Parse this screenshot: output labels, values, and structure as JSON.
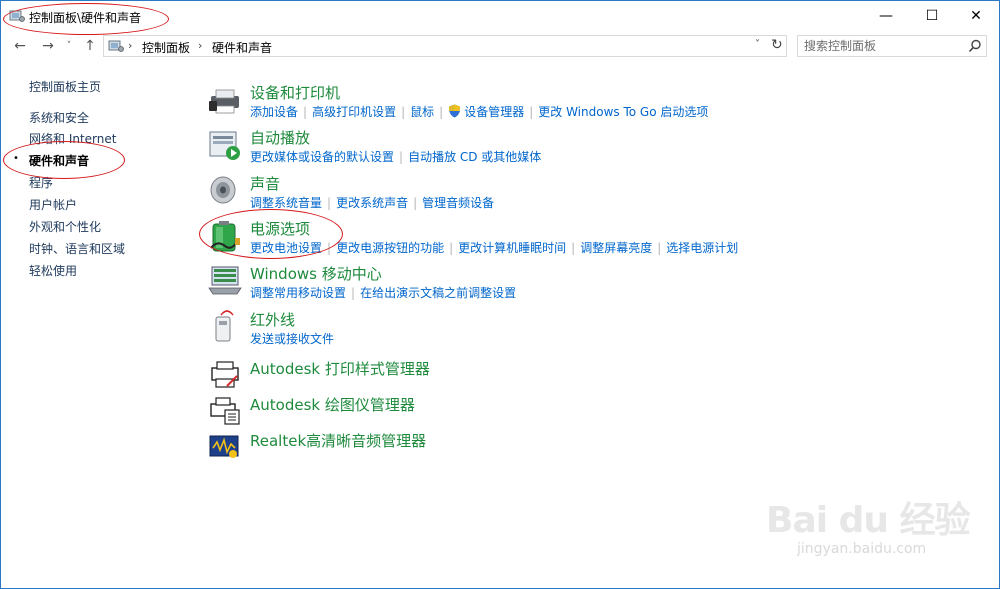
{
  "window": {
    "title": "控制面板\\硬件和声音",
    "minimize": "—",
    "maximize": "☐",
    "close": "✕"
  },
  "nav": {
    "back": "←",
    "forward": "→",
    "recent": "˅",
    "up": "↑",
    "breadcrumb": [
      "控制面板",
      "硬件和声音"
    ],
    "dropdown": "˅",
    "refresh": "↻",
    "search_placeholder": "搜索控制面板"
  },
  "sidebar": {
    "home": "控制面板主页",
    "items": [
      {
        "label": "系统和安全",
        "active": false
      },
      {
        "label": "网络和 Internet",
        "active": false
      },
      {
        "label": "硬件和声音",
        "active": true
      },
      {
        "label": "程序",
        "active": false
      },
      {
        "label": "用户帐户",
        "active": false
      },
      {
        "label": "外观和个性化",
        "active": false
      },
      {
        "label": "时钟、语言和区域",
        "active": false
      },
      {
        "label": "轻松使用",
        "active": false
      }
    ],
    "bullet": "•"
  },
  "categories": [
    {
      "title": "设备和打印机",
      "icon": "printer-icon",
      "links": [
        "添加设备",
        "高级打印机设置",
        "鼠标",
        "设备管理器",
        "更改 Windows To Go 启动选项"
      ]
    },
    {
      "title": "自动播放",
      "icon": "autoplay-icon",
      "links": [
        "更改媒体或设备的默认设置",
        "自动播放 CD 或其他媒体"
      ]
    },
    {
      "title": "声音",
      "icon": "speaker-icon",
      "links": [
        "调整系统音量",
        "更改系统声音",
        "管理音频设备"
      ]
    },
    {
      "title": "电源选项",
      "icon": "battery-icon",
      "links": [
        "更改电池设置",
        "更改电源按钮的功能",
        "更改计算机睡眠时间",
        "调整屏幕亮度",
        "选择电源计划"
      ]
    },
    {
      "title": "Windows 移动中心",
      "icon": "mobility-center-icon",
      "links": [
        "调整常用移动设置",
        "在给出演示文稿之前调整设置"
      ]
    },
    {
      "title": "红外线",
      "icon": "infrared-icon",
      "links": [
        "发送或接收文件"
      ]
    },
    {
      "title": "Autodesk 打印样式管理器",
      "icon": "print-style-manager-icon",
      "links": []
    },
    {
      "title": "Autodesk 绘图仪管理器",
      "icon": "plotter-manager-icon",
      "links": []
    },
    {
      "title": "Realtek高清晰音频管理器",
      "icon": "realtek-audio-icon",
      "links": []
    }
  ],
  "watermark": {
    "brand": "Bai du 经验",
    "url": "jingyan.baidu.com"
  },
  "colors": {
    "link": "#0066cc",
    "category_title": "#1e8a3c",
    "annotation": "#d6191b"
  }
}
